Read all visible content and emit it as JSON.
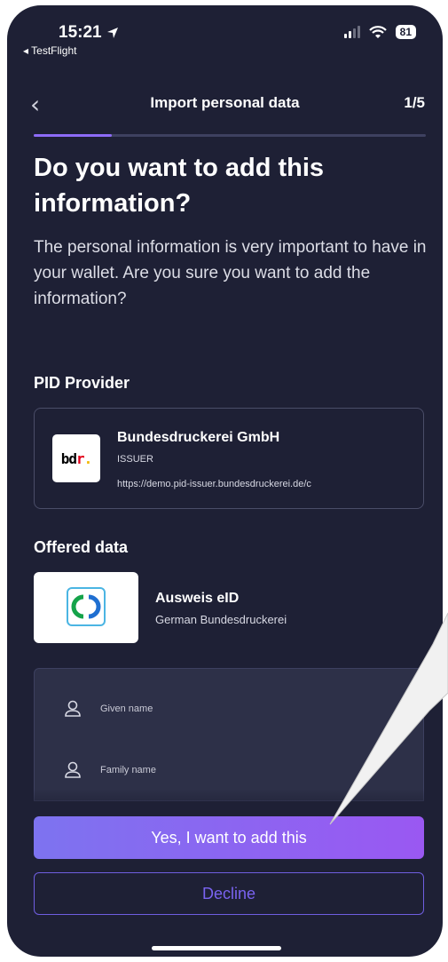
{
  "status_bar": {
    "time": "15:21",
    "back_app": "◂ TestFlight",
    "battery": "81"
  },
  "nav": {
    "back_glyph": "‹",
    "title": "Import personal data",
    "step": "1/5",
    "progress_fraction": 0.2
  },
  "heading": "Do you want to add this information?",
  "subtitle": "The personal information is very important to have in your wallet. Are you sure you want to add the information?",
  "pid_provider": {
    "section_label": "PID Provider",
    "logo_text": "bdr.",
    "name": "Bundesdruckerei GmbH",
    "role": "ISSUER",
    "url": "https://demo.pid-issuer.bundesdruckerei.de/c"
  },
  "offered_data": {
    "section_label": "Offered data",
    "credential_name": "Ausweis eID",
    "credential_issuer": "German Bundesdruckerei",
    "fields": [
      {
        "label": "Given name",
        "icon": "person-icon"
      },
      {
        "label": "Family name",
        "icon": "person-icon"
      }
    ]
  },
  "actions": {
    "confirm_label": "Yes, I want to add this",
    "decline_label": "Decline"
  },
  "colors": {
    "background": "#1e2035",
    "accent": "#8d6bf7",
    "primary_button": "#8a63f2"
  }
}
